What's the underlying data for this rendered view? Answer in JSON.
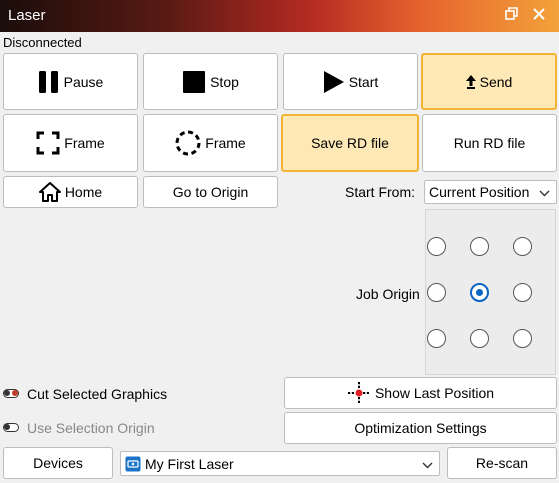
{
  "window": {
    "title": "Laser"
  },
  "status": "Disconnected",
  "buttons": {
    "pause": "Pause",
    "stop": "Stop",
    "start": "Start",
    "send": "Send",
    "frame1": "Frame",
    "frame2": "Frame",
    "save_rd": "Save RD file",
    "run_rd": "Run RD file",
    "home": "Home",
    "go_to_origin": "Go to Origin",
    "show_last_position": "Show Last Position",
    "optimization_settings": "Optimization Settings",
    "devices": "Devices",
    "rescan": "Re-scan"
  },
  "start_from": {
    "label": "Start From:",
    "value": "Current Position"
  },
  "job_origin": {
    "label": "Job Origin",
    "selected": "middle-center"
  },
  "toggles": {
    "cut_selected": "Cut Selected Graphics",
    "use_selection_origin": "Use Selection Origin"
  },
  "device_select": {
    "value": "My First Laser"
  },
  "colors": {
    "highlight_bg": "#fde8b6",
    "highlight_border": "#f5b335",
    "radio_selected": "#0a64c2",
    "target_red": "#e02020"
  }
}
